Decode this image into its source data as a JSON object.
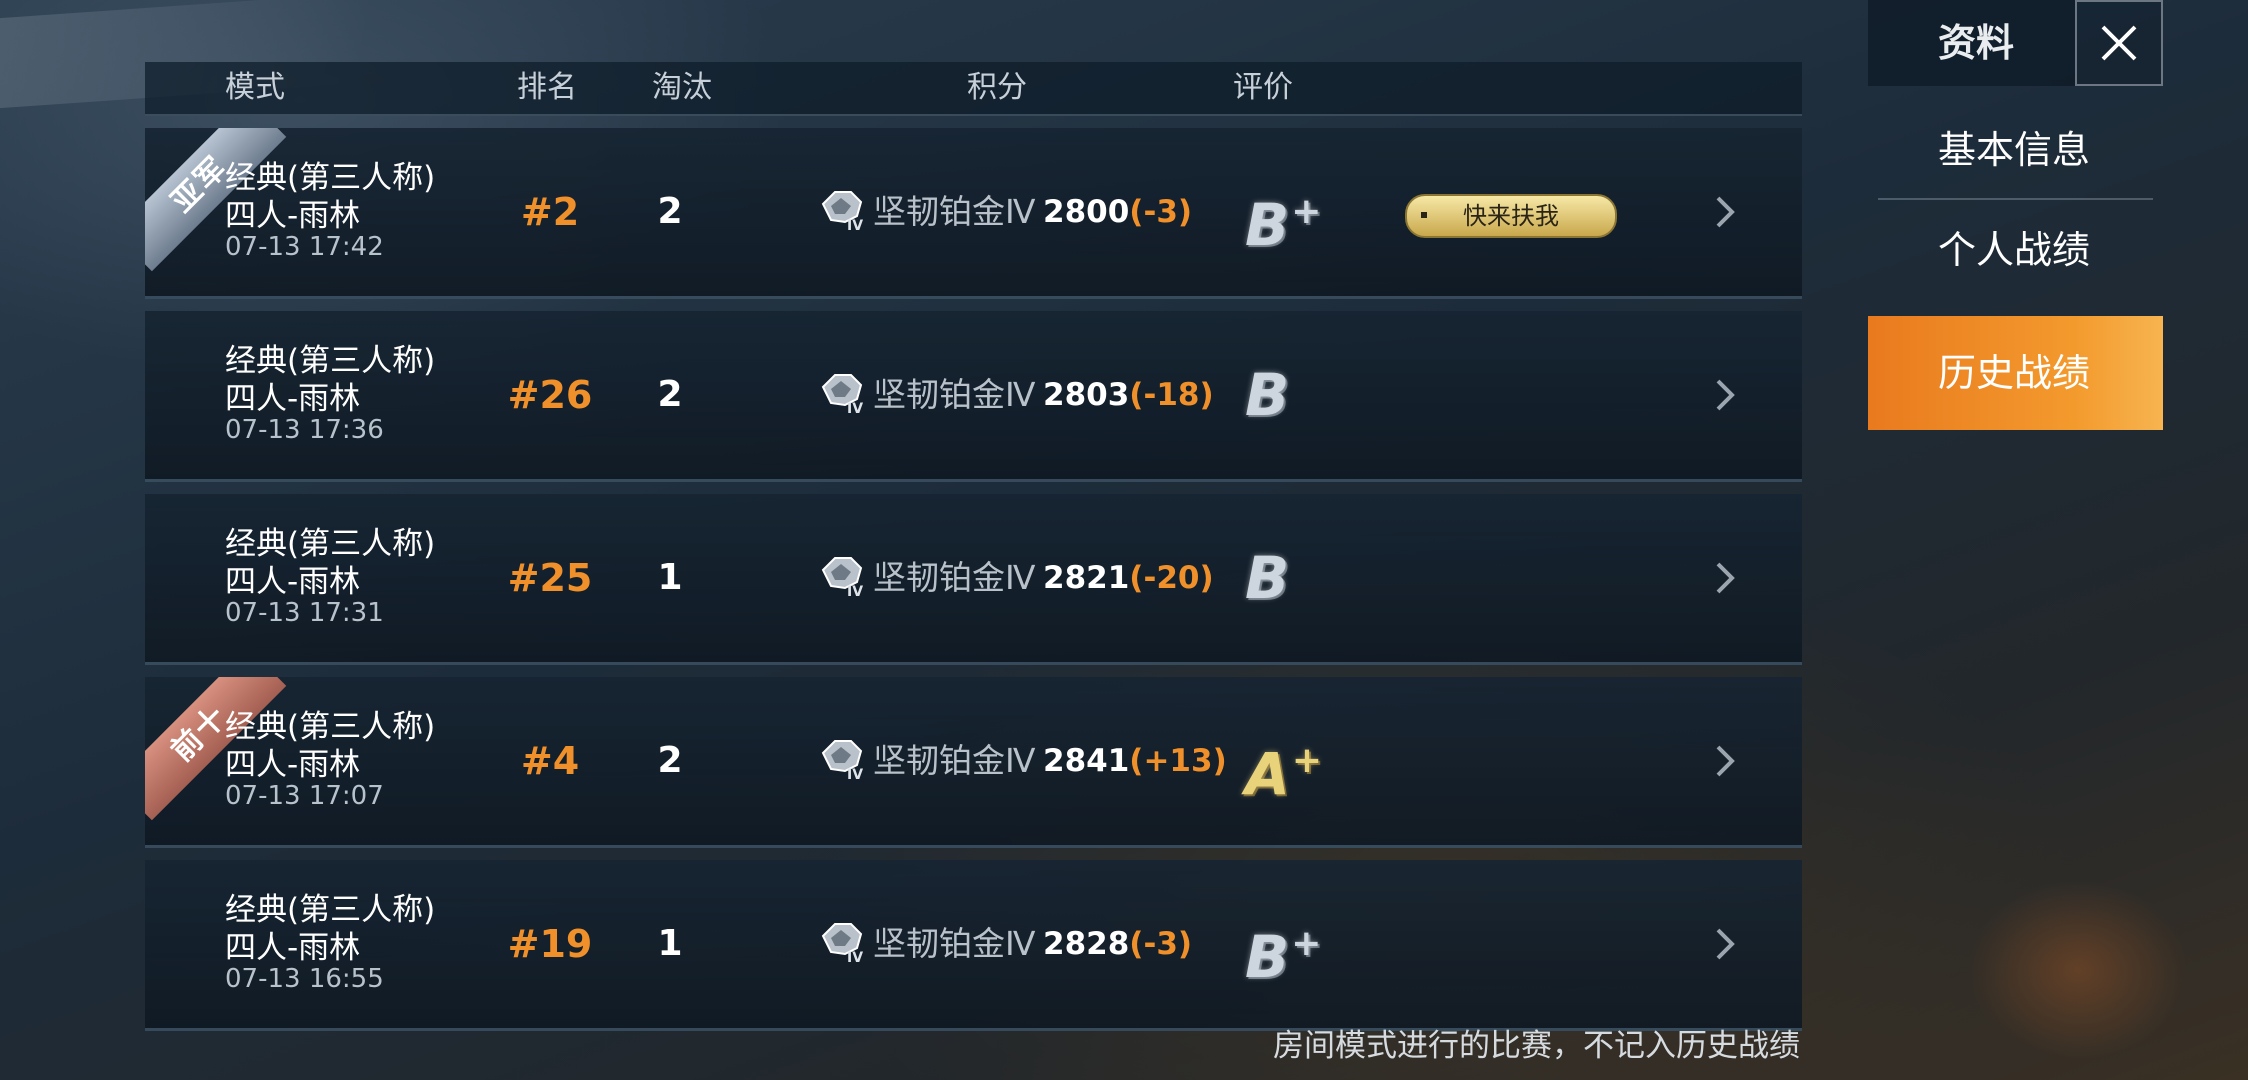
{
  "header": {
    "mode": "模式",
    "rank": "排名",
    "elims": "淘汰",
    "points": "积分",
    "rating": "评价"
  },
  "matches": [
    {
      "ribbon": "亚军",
      "ribbon_style": "silver",
      "mode_line1": "经典(第三人称)",
      "mode_line2": "四人-雨林",
      "datetime": "07-13 17:42",
      "rank": "#2",
      "eliminations": "2",
      "tier_icon": "platinum-tier-IV-icon",
      "tier": "坚韧铂金Ⅳ",
      "score": "2800",
      "delta": "(-3)",
      "grade_letter": "B",
      "grade_plus": "+",
      "grade_color": "silver",
      "badge": "快来扶我"
    },
    {
      "ribbon": "",
      "mode_line1": "经典(第三人称)",
      "mode_line2": "四人-雨林",
      "datetime": "07-13 17:36",
      "rank": "#26",
      "eliminations": "2",
      "tier_icon": "platinum-tier-IV-icon",
      "tier": "坚韧铂金Ⅳ",
      "score": "2803",
      "delta": "(-18)",
      "grade_letter": "B",
      "grade_plus": "",
      "grade_color": "silver",
      "badge": ""
    },
    {
      "ribbon": "",
      "mode_line1": "经典(第三人称)",
      "mode_line2": "四人-雨林",
      "datetime": "07-13 17:31",
      "rank": "#25",
      "eliminations": "1",
      "tier_icon": "platinum-tier-IV-icon",
      "tier": "坚韧铂金Ⅳ",
      "score": "2821",
      "delta": "(-20)",
      "grade_letter": "B",
      "grade_plus": "",
      "grade_color": "silver",
      "badge": ""
    },
    {
      "ribbon": "前十",
      "ribbon_style": "bronze",
      "mode_line1": "经典(第三人称)",
      "mode_line2": "四人-雨林",
      "datetime": "07-13 17:07",
      "rank": "#4",
      "eliminations": "2",
      "tier_icon": "platinum-tier-IV-icon",
      "tier": "坚韧铂金Ⅳ",
      "score": "2841",
      "delta": "(+13)",
      "grade_letter": "A",
      "grade_plus": "+",
      "grade_color": "gold",
      "badge": ""
    },
    {
      "ribbon": "",
      "mode_line1": "经典(第三人称)",
      "mode_line2": "四人-雨林",
      "datetime": "07-13 16:55",
      "rank": "#19",
      "eliminations": "1",
      "tier_icon": "platinum-tier-IV-icon",
      "tier": "坚韧铂金Ⅳ",
      "score": "2828",
      "delta": "(-3)",
      "grade_letter": "B",
      "grade_plus": "+",
      "grade_color": "silver",
      "badge": ""
    }
  ],
  "footer_note": "房间模式进行的比赛，不记入历史战绩",
  "panel": {
    "title": "资料",
    "close_icon": "close-icon",
    "nav": [
      {
        "label": "基本信息",
        "active": false
      },
      {
        "label": "个人战绩",
        "active": false
      },
      {
        "label": "历史战绩",
        "active": true
      }
    ]
  },
  "colors": {
    "accent_orange": "#f0902a",
    "active_tab": "#ef8a24",
    "gold_grade": "#e9d37a",
    "silver_grade": "#cdd6df"
  }
}
